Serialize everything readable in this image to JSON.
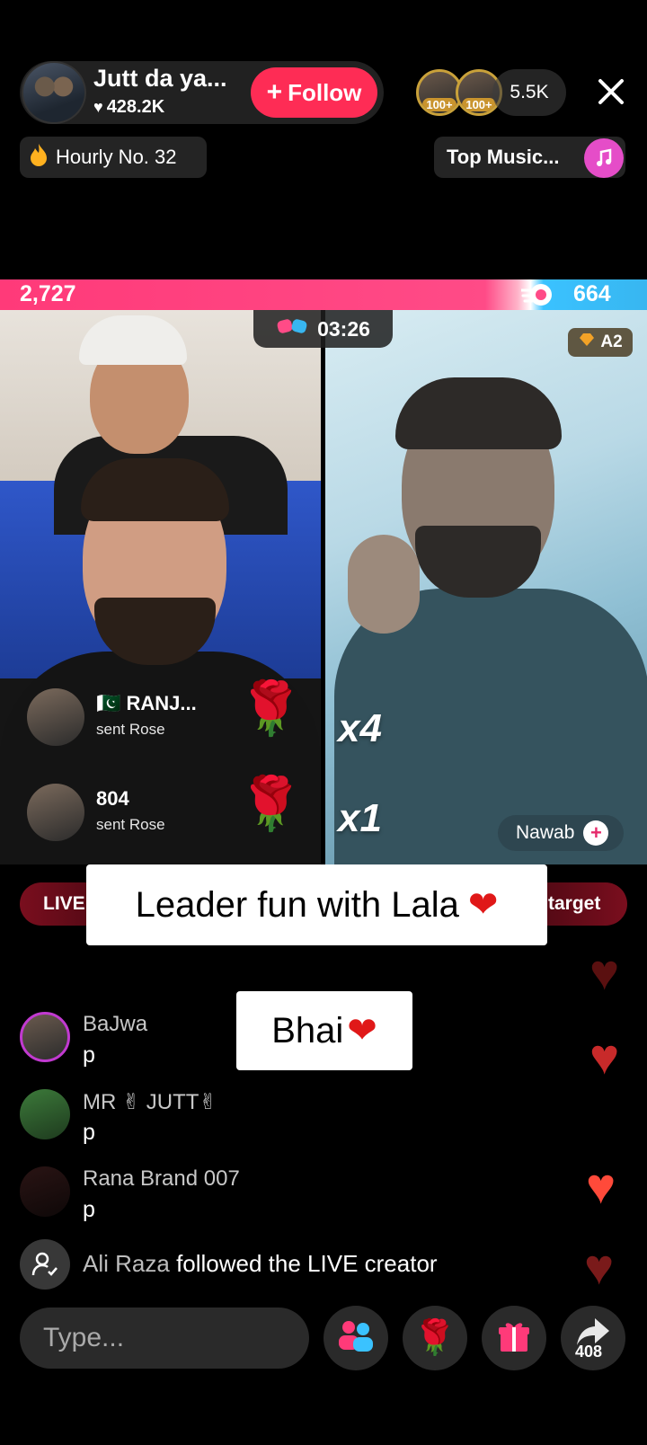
{
  "header": {
    "host_name": "Jutt da ya...",
    "host_likes": "428.2K",
    "follow_label": "Follow",
    "viewer_badges": [
      "100+",
      "100+"
    ],
    "viewer_count": "5.5K",
    "hourly_rank": "Hourly No. 32",
    "music_label": "Top Music..."
  },
  "battle": {
    "score_left": "2,727",
    "score_right": "664",
    "timer": "03:26",
    "right_badge": "A2",
    "multipliers": [
      "x4",
      "x1"
    ],
    "right_user_label": "Nawab"
  },
  "gifts": [
    {
      "name": "RANJ...",
      "action": "sent Rose"
    },
    {
      "name": "804",
      "action": "sent Rose"
    }
  ],
  "strip": {
    "live_label": "LIVE",
    "target_label": "target"
  },
  "captions": {
    "main": "Leader fun with Lala",
    "bhai": "Bhai"
  },
  "chat": [
    {
      "name": "BaJwa",
      "message": "p"
    },
    {
      "name": "MR ✌ JUTT✌",
      "message": "p"
    },
    {
      "name": "Rana Brand 007",
      "message": "p"
    }
  ],
  "follow_notice": {
    "user": "Ali Raza",
    "text": "followed the LIVE creator"
  },
  "bottom_bar": {
    "input_placeholder": "Type...",
    "share_count": "408"
  },
  "colors": {
    "accent_pink": "#fe2c55",
    "battle_left": "#ff3a79",
    "battle_right": "#38b6f0",
    "heart_red": "#e01818"
  }
}
